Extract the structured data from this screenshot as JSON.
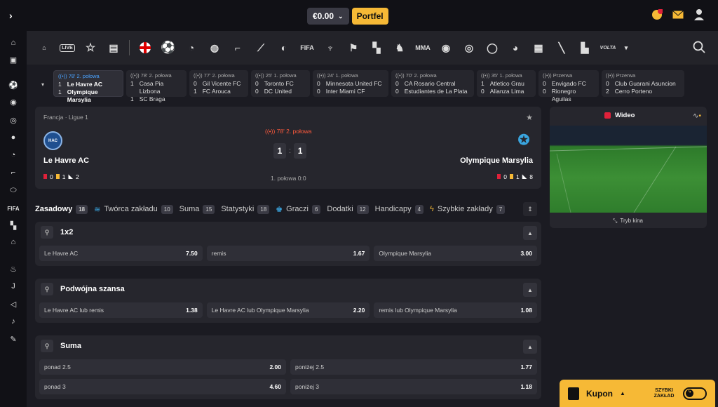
{
  "wallet": {
    "balance": "€0.00",
    "portfel": "Portfel"
  },
  "sports": [
    "house-icon",
    "live-icon",
    "star-icon",
    "betslip-icon",
    "england-flag-icon",
    "football-icon",
    "tennis-icon",
    "basketball-icon",
    "hockey-icon",
    "baseball-icon",
    "volleyball-icon",
    "fifa-icon",
    "badminton-icon",
    "racing-flag-icon",
    "cs-icon",
    "horse-icon",
    "mma-icon",
    "table-tennis-icon",
    "darts-icon",
    "rugby-icon",
    "nba2k-icon",
    "esports-icon",
    "lol-icon",
    "volta-icon"
  ],
  "sportlabels": {
    "live": "LIVE",
    "fifa": "FIFA",
    "mma": "MMA",
    "volta": "VOLTA"
  },
  "live": [
    {
      "status": "78' 2. połowa",
      "h": "1",
      "a": "1",
      "home": "Le Havre AC",
      "away": "Olympique Marsylia"
    },
    {
      "status": "78' 2. połowa",
      "h": "1",
      "a": "1",
      "home": "Casa Pia Lizbona",
      "away": "SC Braga"
    },
    {
      "status": "77' 2. połowa",
      "h": "0",
      "a": "1",
      "home": "Gil Vicente FC",
      "away": "FC Arouca"
    },
    {
      "status": "25' 1. połowa",
      "h": "0",
      "a": "0",
      "home": "Toronto FC",
      "away": "DC United"
    },
    {
      "status": "24' 1. połowa",
      "h": "0",
      "a": "0",
      "home": "Minnesota United FC",
      "away": "Inter Miami CF"
    },
    {
      "status": "70' 2. połowa",
      "h": "0",
      "a": "0",
      "home": "CA Rosario Central",
      "away": "Estudiantes de La Plata"
    },
    {
      "status": "35' 1. połowa",
      "h": "1",
      "a": "0",
      "home": "Atletico Grau",
      "away": "Alianza Lima"
    },
    {
      "status": "Przerwa",
      "h": "0",
      "a": "0",
      "home": "Envigado FC",
      "away": "Rionegro Aguilas"
    },
    {
      "status": "Przerwa",
      "h": "0",
      "a": "2",
      "home": "Club Guarani Asuncion",
      "away": "Cerro Porteno"
    }
  ],
  "match": {
    "league": "Francja · Ligue 1",
    "status": "78' 2. połowa",
    "home": "Le Havre AC",
    "away": "Olympique Marsylia",
    "score_home": "1",
    "score_away": "1",
    "half": "1. połowa 0:0",
    "home_stats": {
      "red": "0",
      "yellow": "1",
      "corners": "2"
    },
    "away_stats": {
      "red": "0",
      "yellow": "1",
      "corners": "8"
    },
    "home_badge": "HAC"
  },
  "video": {
    "label": "Wideo",
    "cinema": "Tryb kina"
  },
  "tabs": [
    {
      "label": "Zasadowy",
      "count": "18"
    },
    {
      "label": "Twórca zakładu",
      "count": "10"
    },
    {
      "label": "Suma",
      "count": "15"
    },
    {
      "label": "Statystyki",
      "count": "18"
    },
    {
      "label": "Graczi",
      "count": "6"
    },
    {
      "label": "Dodatki",
      "count": "12"
    },
    {
      "label": "Handicapy",
      "count": "4"
    },
    {
      "label": "Szybkie zakłady",
      "count": "7"
    }
  ],
  "markets": [
    {
      "title": "1x2",
      "rows": [
        [
          {
            "l": "Le Havre AC",
            "o": "7.50"
          },
          {
            "l": "remis",
            "o": "1.67"
          },
          {
            "l": "Olympique Marsylia",
            "o": "3.00"
          }
        ]
      ]
    },
    {
      "title": "Podwójna szansa",
      "rows": [
        [
          {
            "l": "Le Havre AC lub remis",
            "o": "1.38"
          },
          {
            "l": "Le Havre AC lub Olympique Marsylia",
            "o": "2.20"
          },
          {
            "l": "remis lub Olympique Marsylia",
            "o": "1.08"
          }
        ]
      ]
    },
    {
      "title": "Suma",
      "rows": [
        [
          {
            "l": "ponad 2.5",
            "o": "2.00"
          },
          {
            "l": "poniżej 2.5",
            "o": "1.77"
          }
        ],
        [
          {
            "l": "ponad 3",
            "o": "4.60"
          },
          {
            "l": "poniżej 3",
            "o": "1.18"
          }
        ]
      ]
    }
  ],
  "kupon": {
    "label": "Kupon",
    "quick": "SZYBKI ZAKŁAD"
  },
  "colors": {
    "accent": "#f6b936",
    "bg": "#1b1b22",
    "card": "#26262d",
    "live": "#ff5a3c"
  }
}
